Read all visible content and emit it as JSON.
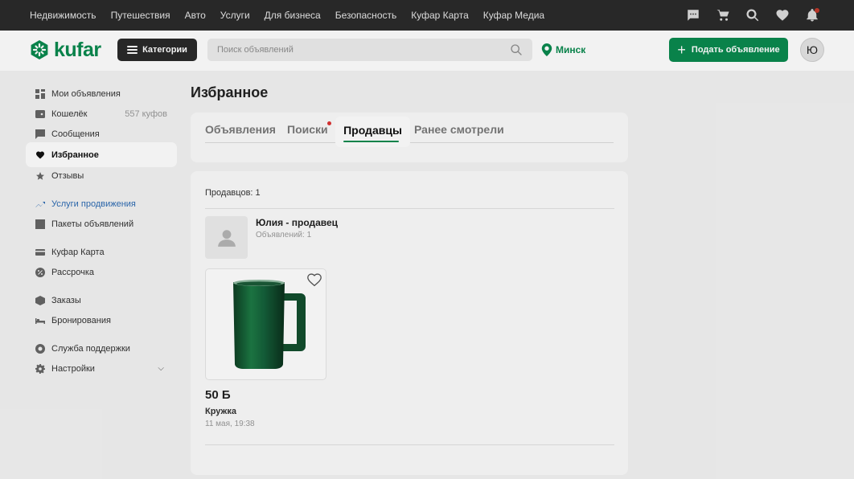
{
  "topbar": {
    "links": [
      "Недвижимость",
      "Путешествия",
      "Авто",
      "Услуги",
      "Для бизнеса",
      "Безопасность",
      "Куфар Карта",
      "Куфар Медиа"
    ]
  },
  "header": {
    "logo_text": "kufar",
    "categories_label": "Категории",
    "search_placeholder": "Поиск объявлений",
    "city": "Минск",
    "post_label": "Подать объявление",
    "avatar_letter": "Ю"
  },
  "sidebar": {
    "items": [
      {
        "label": "Мои объявления"
      },
      {
        "label": "Кошелёк",
        "meta": "557 куфов"
      },
      {
        "label": "Сообщения"
      },
      {
        "label": "Избранное"
      },
      {
        "label": "Отзывы"
      },
      {
        "label": "Услуги продвижения"
      },
      {
        "label": "Пакеты объявлений"
      },
      {
        "label": "Куфар Карта"
      },
      {
        "label": "Рассрочка"
      },
      {
        "label": "Заказы"
      },
      {
        "label": "Бронирования"
      },
      {
        "label": "Служба поддержки"
      },
      {
        "label": "Настройки"
      }
    ]
  },
  "main": {
    "title": "Избранное",
    "tabs": [
      {
        "label": "Объявления"
      },
      {
        "label": "Поиски"
      },
      {
        "label": "Продавцы"
      },
      {
        "label": "Ранее смотрели"
      }
    ],
    "sellers_count": "Продавцов: 1",
    "seller": {
      "name": "Юлия - продавец",
      "ads_count": "Объявлений: 1"
    },
    "product": {
      "price": "50 Б",
      "title": "Кружка",
      "date": "11 мая, 19:38"
    }
  },
  "colors": {
    "brand": "#0a8a4f",
    "topbar": "#2b2b2b",
    "promo": "#2d6bb3",
    "notification": "#d33333"
  }
}
